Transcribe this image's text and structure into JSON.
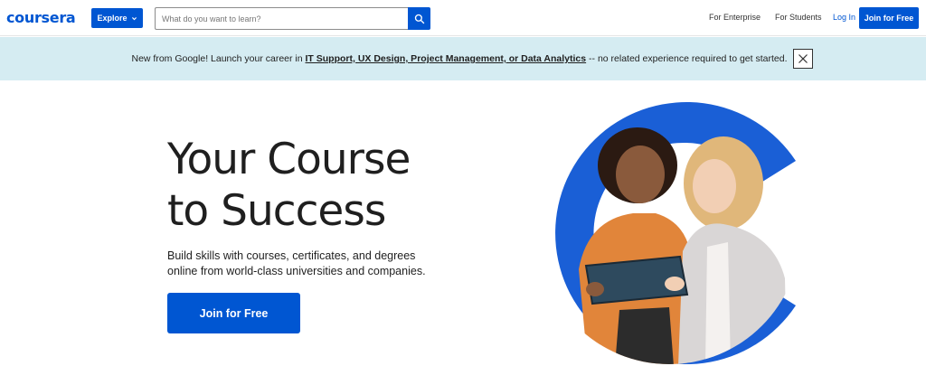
{
  "header": {
    "logo": "coursera",
    "explore_label": "Explore",
    "search_placeholder": "What do you want to learn?",
    "nav": {
      "enterprise": "For Enterprise",
      "students": "For Students",
      "login": "Log In",
      "join": "Join for Free"
    }
  },
  "banner": {
    "prefix": "New from Google! Launch your career in",
    "link": "IT Support, UX Design, Project Management, or Data Analytics",
    "suffix": "-- no related experience required to get started."
  },
  "hero": {
    "title_line1": "Your Course",
    "title_line2": "to Success",
    "subtitle": "Build skills with courses, certificates, and degrees online from world-class universities and companies.",
    "cta": "Join for Free"
  },
  "colors": {
    "brand": "#0056d2",
    "banner_bg": "#d5ecf2",
    "text": "#1f1f1f"
  },
  "icons": [
    "chevron-down-icon",
    "search-icon",
    "close-icon"
  ]
}
